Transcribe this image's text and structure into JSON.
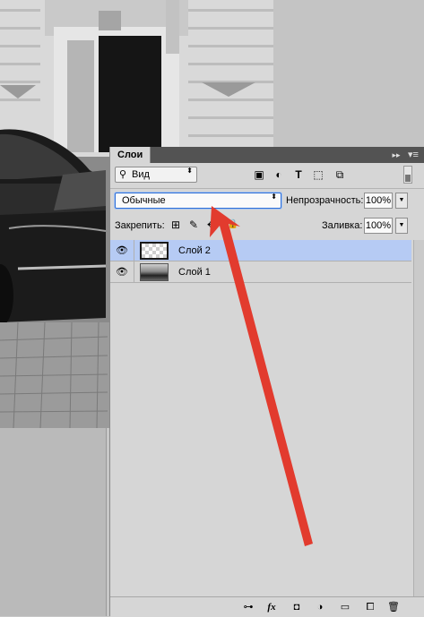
{
  "panel": {
    "tab_label": "Слои",
    "collapse_glyph": "▸▸",
    "menu_glyph": "▾≡"
  },
  "filter": {
    "search_glyph": "⚲",
    "label": "Вид",
    "arrow_glyph": "⬍",
    "icons": [
      {
        "name": "pixel-filter-icon",
        "glyph": "▣"
      },
      {
        "name": "adjustment-filter-icon",
        "glyph": "◐"
      },
      {
        "name": "type-filter-icon",
        "glyph": "T"
      },
      {
        "name": "shape-filter-icon",
        "glyph": "⬚"
      },
      {
        "name": "smart-object-filter-icon",
        "glyph": "⧉"
      }
    ]
  },
  "blend": {
    "mode": "Обычные",
    "arrow_glyph": "⬍",
    "opacity_label": "Непрозрачность:",
    "opacity_value": "100%"
  },
  "lock": {
    "label": "Закрепить:",
    "icons": [
      {
        "name": "lock-transparent-pixels-icon",
        "glyph": "⊞"
      },
      {
        "name": "lock-image-pixels-icon",
        "glyph": "✎"
      },
      {
        "name": "lock-position-icon",
        "glyph": "✥"
      },
      {
        "name": "lock-all-icon",
        "glyph": "🔒"
      }
    ],
    "fill_label": "Заливка:",
    "fill_value": "100%"
  },
  "layers": [
    {
      "name": "Слой 2",
      "selected": true,
      "visible": true,
      "thumb": "transparent"
    },
    {
      "name": "Слой 1",
      "selected": false,
      "visible": true,
      "thumb": "image"
    }
  ],
  "bottom_toolbar": [
    {
      "name": "link-layers-icon",
      "glyph": "⊶"
    },
    {
      "name": "layer-style-fx-icon",
      "glyph": "fx"
    },
    {
      "name": "add-mask-icon",
      "glyph": "◘"
    },
    {
      "name": "new-adjustment-layer-icon",
      "glyph": "◑"
    },
    {
      "name": "new-group-folder-icon",
      "glyph": "▭"
    },
    {
      "name": "new-layer-icon",
      "glyph": "⧠"
    },
    {
      "name": "delete-layer-trash-icon",
      "glyph": "🗑"
    }
  ],
  "colors": {
    "selection": "#b6cbf4",
    "panel_bg": "#d6d6d6",
    "arrow": "#e23b2e"
  }
}
